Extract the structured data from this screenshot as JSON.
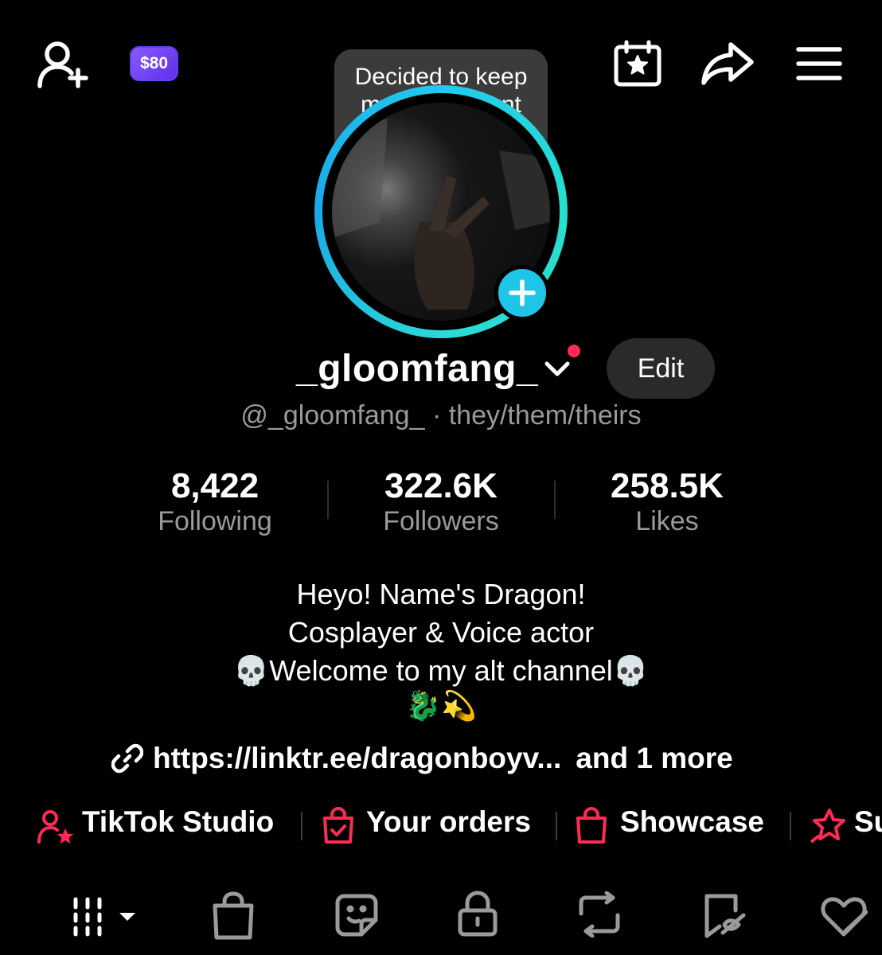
{
  "header": {
    "coins_label": "$80",
    "note_text": "Decided to keep my old account but c...",
    "icons": {
      "add_friend": "add-friend-icon",
      "calendar": "calendar-star-icon",
      "share": "share-arrow-icon",
      "menu": "menu-icon"
    }
  },
  "profile": {
    "username": "_gloomfang_",
    "edit_label": "Edit",
    "handle_line": "@_gloomfang_ · they/them/theirs",
    "stats": [
      {
        "value": "8,422",
        "label": "Following"
      },
      {
        "value": "322.6K",
        "label": "Followers"
      },
      {
        "value": "258.5K",
        "label": "Likes"
      }
    ],
    "bio": [
      "Heyo! Name's Dragon!",
      "Cosplayer & Voice actor",
      "💀Welcome to my alt channel💀",
      "🐉💫"
    ],
    "link_text": "https://linktr.ee/dragonboyv...",
    "link_more": "and 1 more"
  },
  "shortcuts": [
    {
      "label": "TikTok Studio",
      "icon": "studio-person-star-icon"
    },
    {
      "label": "Your orders",
      "icon": "orders-bag-icon"
    },
    {
      "label": "Showcase",
      "icon": "showcase-bag-icon"
    },
    {
      "label": "Su",
      "icon": "subscription-star-icon"
    }
  ],
  "content_tabs": [
    {
      "name": "videos-grid-icon"
    },
    {
      "name": "shop-bag-icon"
    },
    {
      "name": "stickers-icon"
    },
    {
      "name": "private-lock-icon"
    },
    {
      "name": "reposts-icon"
    },
    {
      "name": "favorites-bookmark-icon"
    },
    {
      "name": "liked-heart-icon"
    }
  ],
  "colors": {
    "background": "#000000",
    "accent_red": "#ff2b55",
    "accent_cyan": "#1fc4e9",
    "coin_purple": "#6a3cf0",
    "muted_text": "#9a9a9a"
  }
}
